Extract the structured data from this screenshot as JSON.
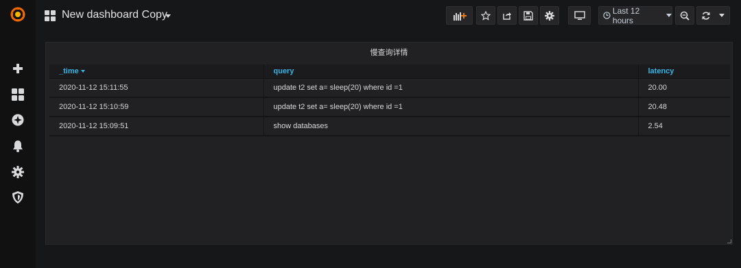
{
  "header": {
    "title": "New dashboard Copy",
    "time_range_label": "Last 12 hours"
  },
  "icons": {
    "logo": "grafana-logo-icon",
    "apps": "dashboard-grid-icon",
    "add_panel": "add-panel-icon",
    "star": "star-icon",
    "share": "share-icon",
    "save": "save-icon",
    "settings": "gear-icon",
    "tv": "monitor-icon",
    "clock": "clock-icon",
    "zoom": "zoom-out-icon",
    "refresh": "refresh-icon"
  },
  "sidebar": {
    "items": [
      {
        "icon": "plus-icon"
      },
      {
        "icon": "dashboards-icon"
      },
      {
        "icon": "explore-compass-icon"
      },
      {
        "icon": "bell-icon"
      },
      {
        "icon": "gear-icon"
      },
      {
        "icon": "shield-icon"
      }
    ]
  },
  "panel": {
    "title": "慢查询详情",
    "columns": [
      "_time",
      "query",
      "latency"
    ],
    "rows": [
      [
        "2020-11-12 15:11:55",
        "update t2 set a= sleep(20) where id =1",
        "20.00"
      ],
      [
        "2020-11-12 15:10:59",
        "update t2 set a= sleep(20) where id =1",
        "20.48"
      ],
      [
        "2020-11-12 15:09:51",
        "show databases",
        "2.54"
      ]
    ]
  },
  "colors": {
    "accent": "#33b5e5",
    "logo": "#f46800",
    "background": "#161719",
    "panel": "#212124"
  }
}
